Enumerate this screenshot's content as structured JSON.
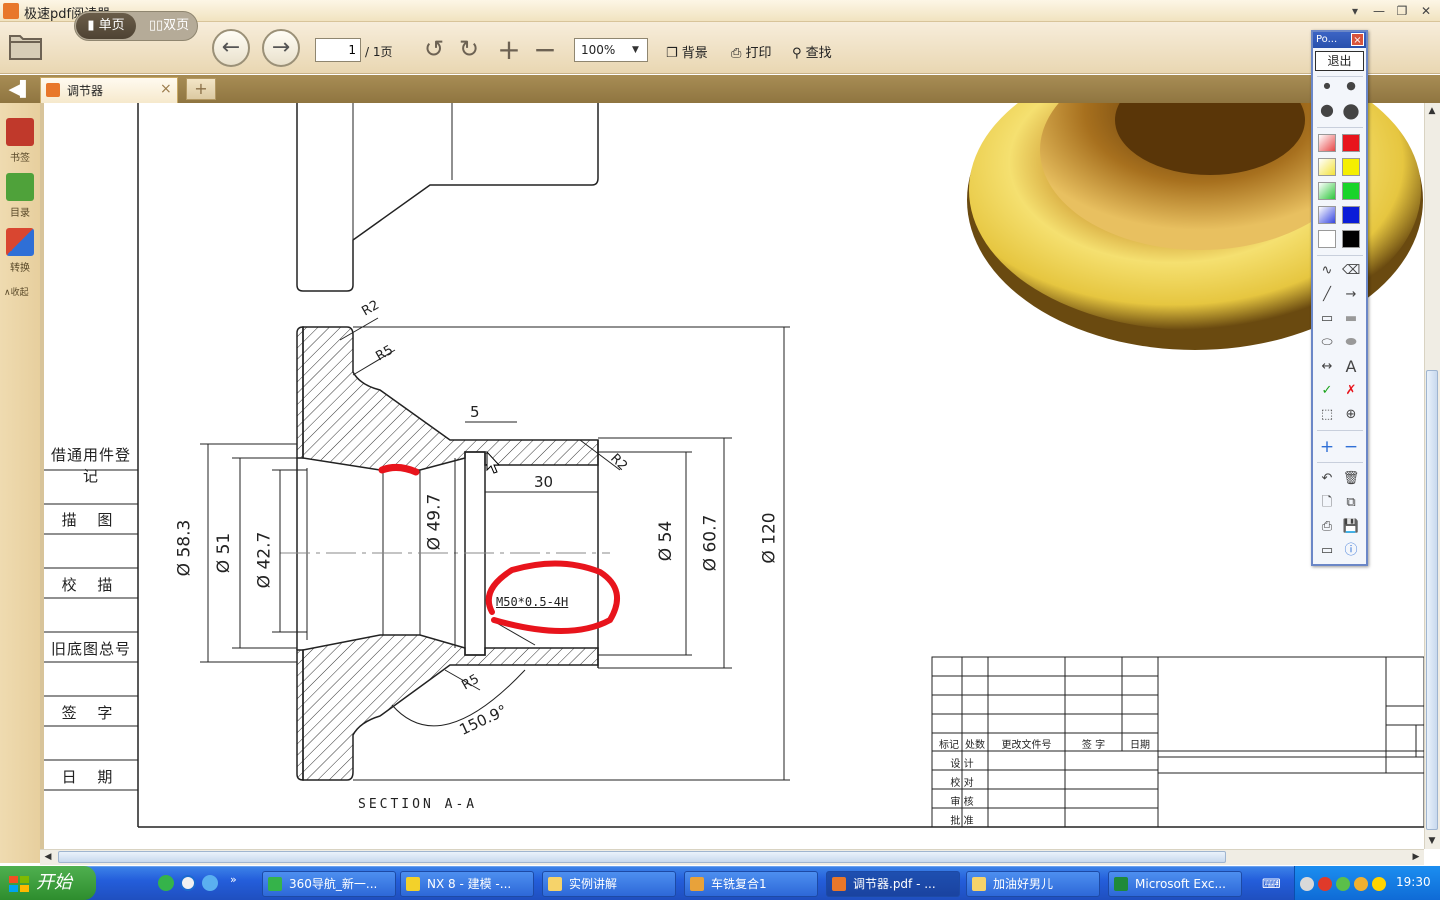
{
  "app": {
    "title": "极速pdf阅读器"
  },
  "window_controls": {
    "menu": "▾",
    "minimize": "—",
    "restore": "❐",
    "close": "✕"
  },
  "toolbar": {
    "single_page": "单页",
    "double_page": "双页",
    "page_current": "1",
    "page_total": "/ 1页",
    "zoom": "100%",
    "background": "背景",
    "print": "打印",
    "find": "查找"
  },
  "tabs": {
    "doc_tab_label": "调节器",
    "close": "×",
    "new_tab": "+"
  },
  "sidebar": {
    "bookmarks": "书签",
    "toc": "目录",
    "convert": "转换",
    "collapse": "∧收起"
  },
  "drawing": {
    "dims": {
      "r2_top": "R2",
      "r5_top": "R5",
      "five": "5",
      "r2_right": "R2",
      "thirty": "30",
      "d583": "Ø 58.3",
      "d51": "Ø 51",
      "d427": "Ø 42.7",
      "d497": "Ø 49.7",
      "d54": "Ø 54",
      "d607": "Ø 60.7",
      "d120": "Ø 120",
      "thread": "M50*0.5-4H",
      "r5_bottom": "R5",
      "angle": "150.9°"
    },
    "section_label": "SECTION A-A",
    "left_table": [
      "借通用件登记",
      "描 图",
      "校 描",
      "旧底图总号",
      "签 字",
      "日 期"
    ],
    "title_block": {
      "header": [
        "标记",
        "处数",
        "更改文件号",
        "签 字",
        "日期"
      ],
      "rows": [
        "设 计",
        "校 对",
        "审 核",
        "批 准"
      ]
    }
  },
  "pen_panel": {
    "title": "Po...",
    "close": "×",
    "exit": "退出"
  },
  "colors": {
    "accent_orange": "#e8772a",
    "toolbar_bg": "#f1e3c0",
    "tabbar_bg": "#9c8048",
    "annotation_red": "#e8141c",
    "taskbar_blue": "#245edb"
  },
  "taskbar": {
    "start": "开始",
    "items": [
      "360导航_新一...",
      "NX 8 - 建模 -...",
      "实例讲解",
      "车铣复合1",
      "调节器.pdf - ...",
      "加油好男儿",
      "Microsoft Exc..."
    ],
    "clock": "19:30"
  }
}
